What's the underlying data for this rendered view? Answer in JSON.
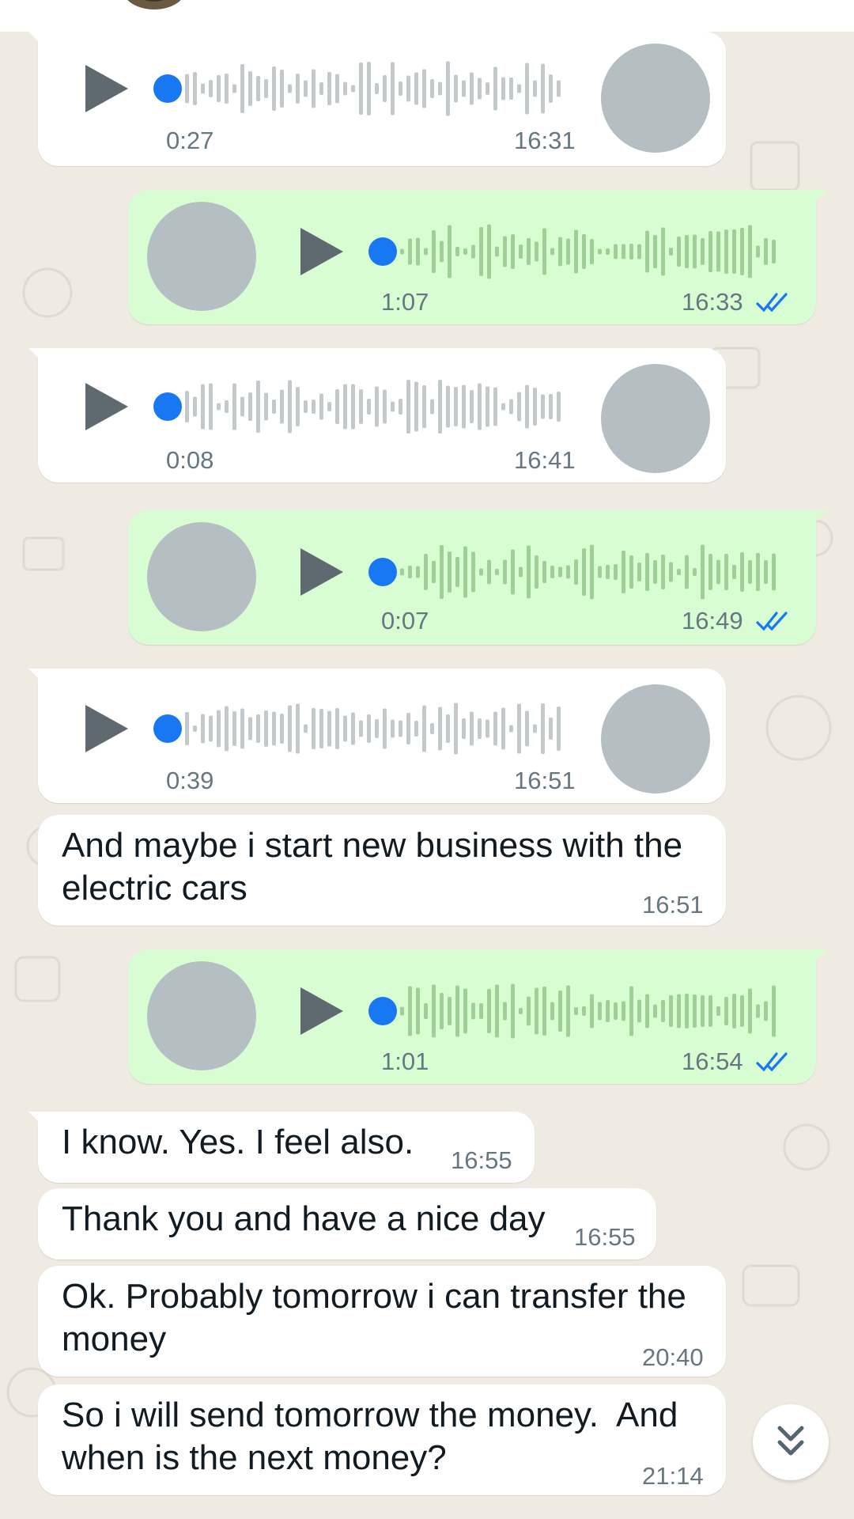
{
  "header": {
    "avatar_icon": "contact-avatar-icon"
  },
  "colors": {
    "incoming_bubble": "#ffffff",
    "outgoing_bubble": "#d9fdd3",
    "voice_progress_dot": "#1877f2",
    "read_ticks": "#1877f2",
    "meta_text": "#667781",
    "wallpaper": "#efeae2"
  },
  "messages": [
    {
      "direction": "incoming",
      "type": "voice",
      "duration": "0:27",
      "time": "16:31"
    },
    {
      "direction": "outgoing",
      "type": "voice",
      "duration": "1:07",
      "time": "16:33",
      "status": "read"
    },
    {
      "direction": "incoming",
      "type": "voice",
      "duration": "0:08",
      "time": "16:41"
    },
    {
      "direction": "outgoing",
      "type": "voice",
      "duration": "0:07",
      "time": "16:49",
      "status": "read"
    },
    {
      "direction": "incoming",
      "type": "voice",
      "duration": "0:39",
      "time": "16:51"
    },
    {
      "direction": "incoming",
      "type": "text",
      "text": "And maybe i start new business with the electric cars",
      "time": "16:51"
    },
    {
      "direction": "outgoing",
      "type": "voice",
      "duration": "1:01",
      "time": "16:54",
      "status": "read"
    },
    {
      "direction": "incoming",
      "type": "text",
      "text": "I know. Yes. I feel also.",
      "time": "16:55"
    },
    {
      "direction": "incoming",
      "type": "text",
      "text": "Thank you and have a nice day",
      "time": "16:55"
    },
    {
      "direction": "incoming",
      "type": "text",
      "text": "Ok. Probably tomorrow i can transfer the money",
      "time": "20:40"
    },
    {
      "direction": "incoming",
      "type": "text",
      "text": "So i will send tomorrow the money.  And when is the next money?",
      "time": "21:14"
    }
  ],
  "scroll_down_icon": "double-chevron-down-icon"
}
